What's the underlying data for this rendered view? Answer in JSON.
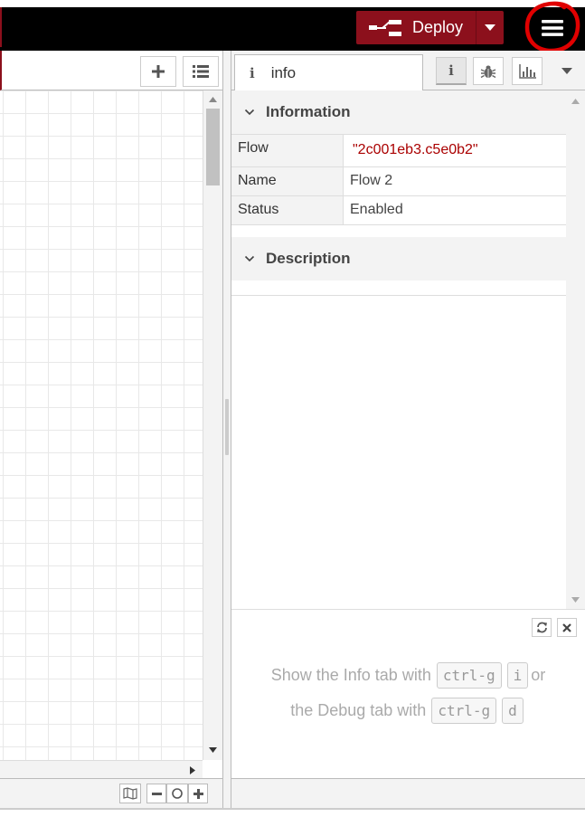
{
  "header": {
    "deploy_label": "Deploy",
    "accent_color": "#8c101c",
    "highlight_color": "#e00000"
  },
  "workspace": {
    "add_flow_icon": "plus-icon",
    "flow_list_icon": "list-icon"
  },
  "sidebar": {
    "active_tab_label": "info",
    "tab_buttons": [
      "info-icon",
      "bug-icon",
      "chart-icon"
    ],
    "information": {
      "title": "Information",
      "rows": [
        {
          "key": "Flow",
          "value": "\"2c001eb3.c5e0b2\""
        },
        {
          "key": "Name",
          "value": "Flow 2"
        },
        {
          "key": "Status",
          "value": "Enabled"
        }
      ]
    },
    "description": {
      "title": "Description"
    }
  },
  "help": {
    "line1_prefix": "Show the Info tab with",
    "line1_key1": "ctrl-g",
    "line1_key2": "i",
    "line1_suffix": "or",
    "line2_prefix": "the Debug tab with",
    "line2_key1": "ctrl-g",
    "line2_key2": "d"
  }
}
